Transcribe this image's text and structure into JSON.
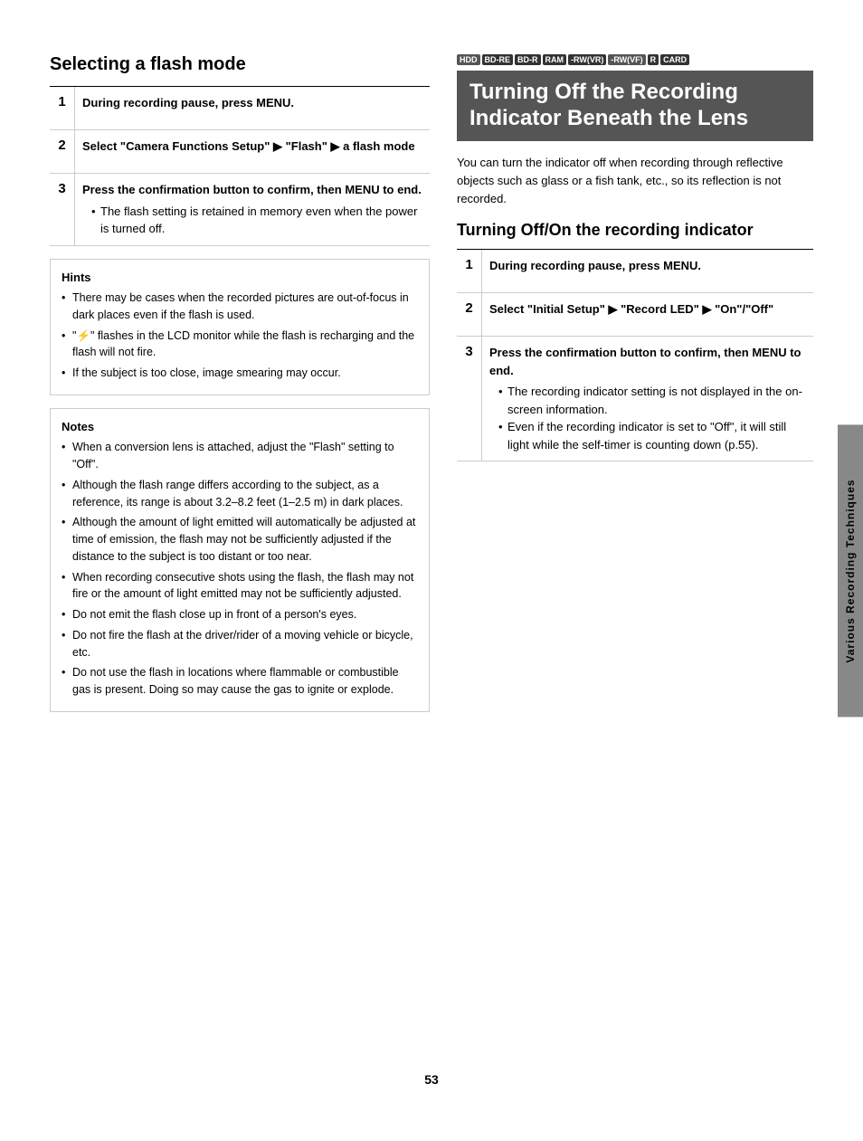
{
  "left": {
    "title": "Selecting a flash mode",
    "steps": [
      {
        "num": "1",
        "main": "During recording pause, press MENU."
      },
      {
        "num": "2",
        "main": "Select “Camera Functions Setup” ▶ “Flash” ▶ a flash mode"
      },
      {
        "num": "3",
        "main": "Press the confirmation button to confirm, then MENU to end.",
        "bullets": [
          "The flash setting is retained in memory even when the power is turned off."
        ]
      }
    ],
    "hints": {
      "title": "Hints",
      "items": [
        "There may be cases when the recorded pictures are out-of-focus in dark places even if the flash is used.",
        "“ ⚡ ” flashes in the LCD monitor while the flash is recharging and the flash will not fire.",
        "If the subject is too close, image smearing may occur."
      ]
    },
    "notes": {
      "title": "Notes",
      "items": [
        "When a conversion lens is attached, adjust the “Flash” setting to “Off”.",
        "Although the flash range differs according to the subject, as a reference, its range is about 3.2–8.2 feet (1–2.5 m) in dark places.",
        "Although the amount of light emitted will automatically be adjusted at time of emission, the flash may not be sufficiently adjusted if the distance to the subject is too distant or too near.",
        "When recording consecutive shots using the flash, the flash may not fire or the amount of light emitted may not be sufficiently adjusted.",
        "Do not emit the flash close up in front of a person’s eyes.",
        "Do not fire the flash at the driver/rider of a moving vehicle or bicycle, etc.",
        "Do not use the flash in locations where flammable or combustible gas is present. Doing so may cause the gas to ignite or explode."
      ]
    }
  },
  "right": {
    "badges": [
      "HDD",
      "BD-RE",
      "BD-R",
      "RAM",
      "-RW(VR)",
      "-RW(VF)",
      "R",
      "CARD"
    ],
    "highlight_title": "Turning Off the Recording Indicator Beneath the Lens",
    "desc": "You can turn the indicator off when recording through reflective objects such as glass or a fish tank, etc., so its reflection is not recorded.",
    "subsection_title": "Turning Off/On the recording indicator",
    "steps": [
      {
        "num": "1",
        "main": "During recording pause, press MENU."
      },
      {
        "num": "2",
        "main": "Select “Initial Setup” ▶ “Record LED” ▶ “On”/“Off”"
      },
      {
        "num": "3",
        "main": "Press the confirmation button to confirm, then MENU to end.",
        "bullets": [
          "The recording indicator setting is not displayed in the on-screen information.",
          "Even if the recording indicator is set to “Off”, it will still light while the self-timer is counting down (p.55)."
        ]
      }
    ]
  },
  "sidebar_label": "Various Recording Techniques",
  "page_number": "53"
}
